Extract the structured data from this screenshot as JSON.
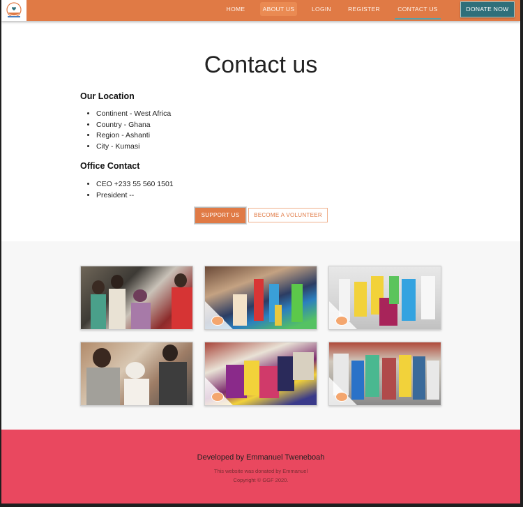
{
  "nav": {
    "logo_name": "hands-heart-logo",
    "items": [
      {
        "label": "HOME"
      },
      {
        "label": "ABOUT US"
      },
      {
        "label": "LOGIN"
      },
      {
        "label": "REGISTER"
      },
      {
        "label": "CONTACT US"
      }
    ],
    "donate_label": "DONATE NOW",
    "bar_color": "#e07a45"
  },
  "contact": {
    "title": "Contact us",
    "location_heading": "Our Location",
    "location_items": [
      "Continent - West Africa",
      "Country - Ghana",
      "Region - Ashanti",
      "City - Kumasi"
    ],
    "office_heading": "Office Contact",
    "office_items": [
      "CEO +233 55 560 1501",
      "President --"
    ],
    "support_label": "SUPPORT US",
    "volunteer_label": "BECOME A VOLUNTEER"
  },
  "gallery": {
    "photos": [
      {
        "name": "community-outreach-photo-1"
      },
      {
        "name": "street-outreach-photo-2"
      },
      {
        "name": "group-photo-3"
      },
      {
        "name": "community-photo-4"
      },
      {
        "name": "street-outreach-photo-5"
      },
      {
        "name": "street-group-photo-6"
      }
    ]
  },
  "footer": {
    "developer": "Developed by Emmanuel Tweneboah",
    "donated": "This website was donated by Emmanuel",
    "copyright": "Copyright © GGF 2020.",
    "color": "#e9485f"
  }
}
